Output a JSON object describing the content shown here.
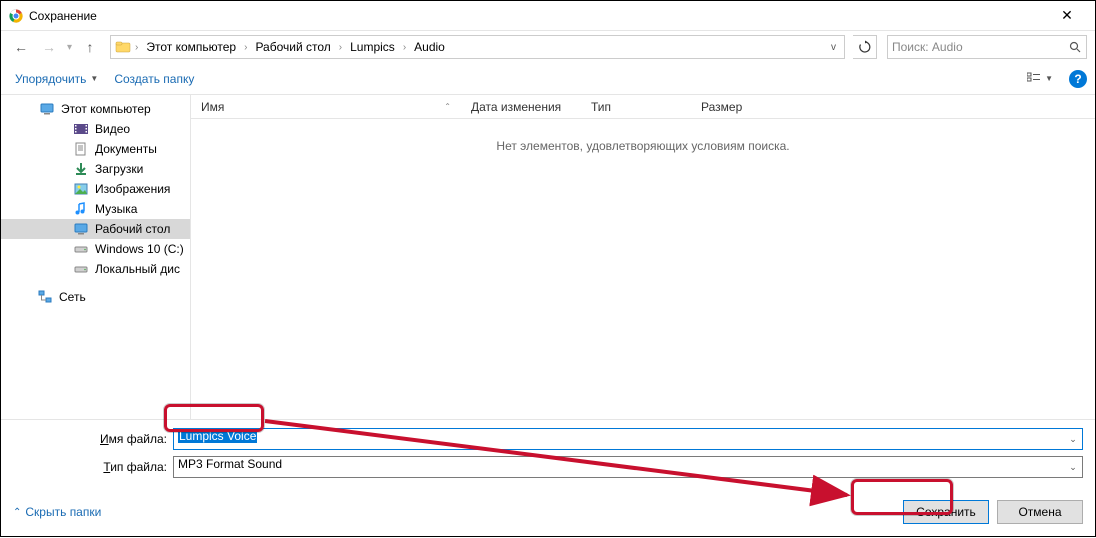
{
  "title": "Сохранение",
  "breadcrumbs": [
    "Этот компьютер",
    "Рабочий стол",
    "Lumpics",
    "Audio"
  ],
  "search_placeholder": "Поиск: Audio",
  "toolbar": {
    "organize": "Упорядочить",
    "new_folder": "Создать папку"
  },
  "tree": {
    "this_pc": "Этот компьютер",
    "video": "Видео",
    "documents": "Документы",
    "downloads": "Загрузки",
    "pictures": "Изображения",
    "music": "Музыка",
    "desktop": "Рабочий стол",
    "drive_c": "Windows 10 (C:)",
    "drive_local": "Локальный дис",
    "network": "Сеть"
  },
  "columns": {
    "name": "Имя",
    "date": "Дата изменения",
    "type": "Тип",
    "size": "Размер"
  },
  "empty_message": "Нет элементов, удовлетворяющих условиям поиска.",
  "fields": {
    "filename_label_u": "И",
    "filename_label_rest": "мя файла:",
    "filename_value": "Lumpics Voice",
    "filetype_label_u": "Т",
    "filetype_label_rest": "ип файла:",
    "filetype_value": "MP3 Format Sound"
  },
  "footer": {
    "hide_folders": "Скрыть папки",
    "save": "Сохранить",
    "cancel": "Отмена"
  }
}
